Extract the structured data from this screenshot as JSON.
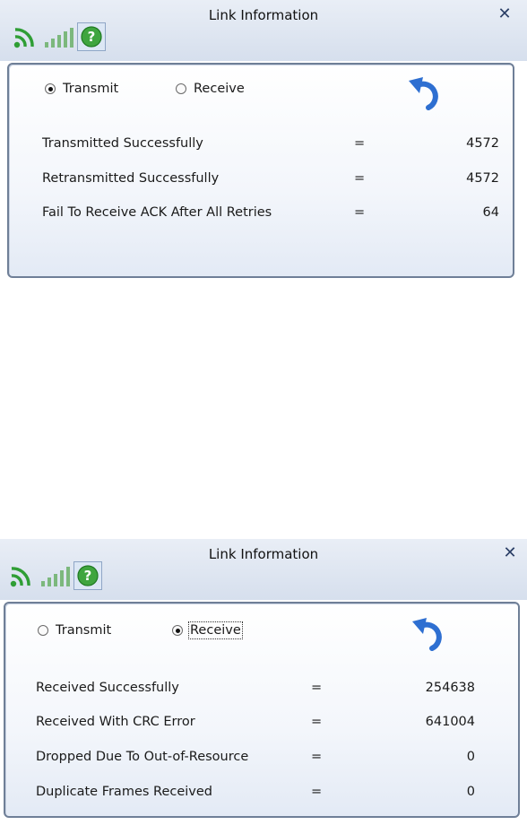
{
  "colors": {
    "signal_green": "#2f9e35",
    "accent_blue": "#2e6fd1",
    "border": "#6f7f97"
  },
  "dialogs": [
    {
      "title": "Link Information",
      "close_symbol": "✕",
      "help_symbol": "?",
      "radios": [
        {
          "label": "Transmit",
          "checked": true
        },
        {
          "label": "Receive",
          "checked": false
        }
      ],
      "stats": [
        {
          "label": "Transmitted Successfully",
          "eq": "=",
          "value": "4572"
        },
        {
          "label": "Retransmitted Successfully",
          "eq": "=",
          "value": "4572"
        },
        {
          "label": "Fail To Receive ACK After All Retries",
          "eq": "=",
          "value": "64"
        }
      ]
    },
    {
      "title": "Link Information",
      "close_symbol": "✕",
      "help_symbol": "?",
      "radios": [
        {
          "label": "Transmit",
          "checked": false
        },
        {
          "label": "Receive",
          "checked": true
        }
      ],
      "stats": [
        {
          "label": "Received Successfully",
          "eq": "=",
          "value": "254638"
        },
        {
          "label": "Received With CRC Error",
          "eq": "=",
          "value": "641004"
        },
        {
          "label": "Dropped Due To Out-of-Resource",
          "eq": "=",
          "value": "0"
        },
        {
          "label": "Duplicate Frames Received",
          "eq": "=",
          "value": "0"
        }
      ]
    }
  ]
}
